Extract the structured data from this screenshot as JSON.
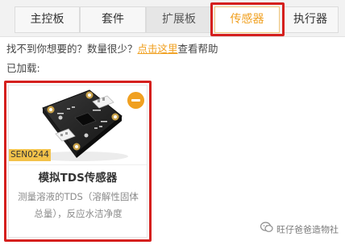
{
  "tabs": [
    {
      "label": "主控板",
      "state": "normal"
    },
    {
      "label": "套件",
      "state": "normal"
    },
    {
      "label": "扩展板",
      "state": "hover"
    },
    {
      "label": "传感器",
      "state": "selected"
    },
    {
      "label": "执行器",
      "state": "normal"
    }
  ],
  "hint": {
    "prefix": "找不到你想要的？数量很少？",
    "link": "点击这里",
    "suffix": "查看帮助"
  },
  "loaded_label": "已加载:",
  "card": {
    "sku": "SEN0244",
    "title": "模拟TDS传感器",
    "description": "测量溶液的TDS（溶解性固体总量），反应水洁净度",
    "remove_icon": "minus-circle-icon",
    "image_icon": "tds-sensor-board-image"
  },
  "watermark": {
    "text": "旺仔爸爸造物社",
    "icon": "wechat-watermark-icon"
  },
  "colors": {
    "accent": "#f0a020",
    "highlight": "#d5201e",
    "badge": "#f3c24a"
  }
}
